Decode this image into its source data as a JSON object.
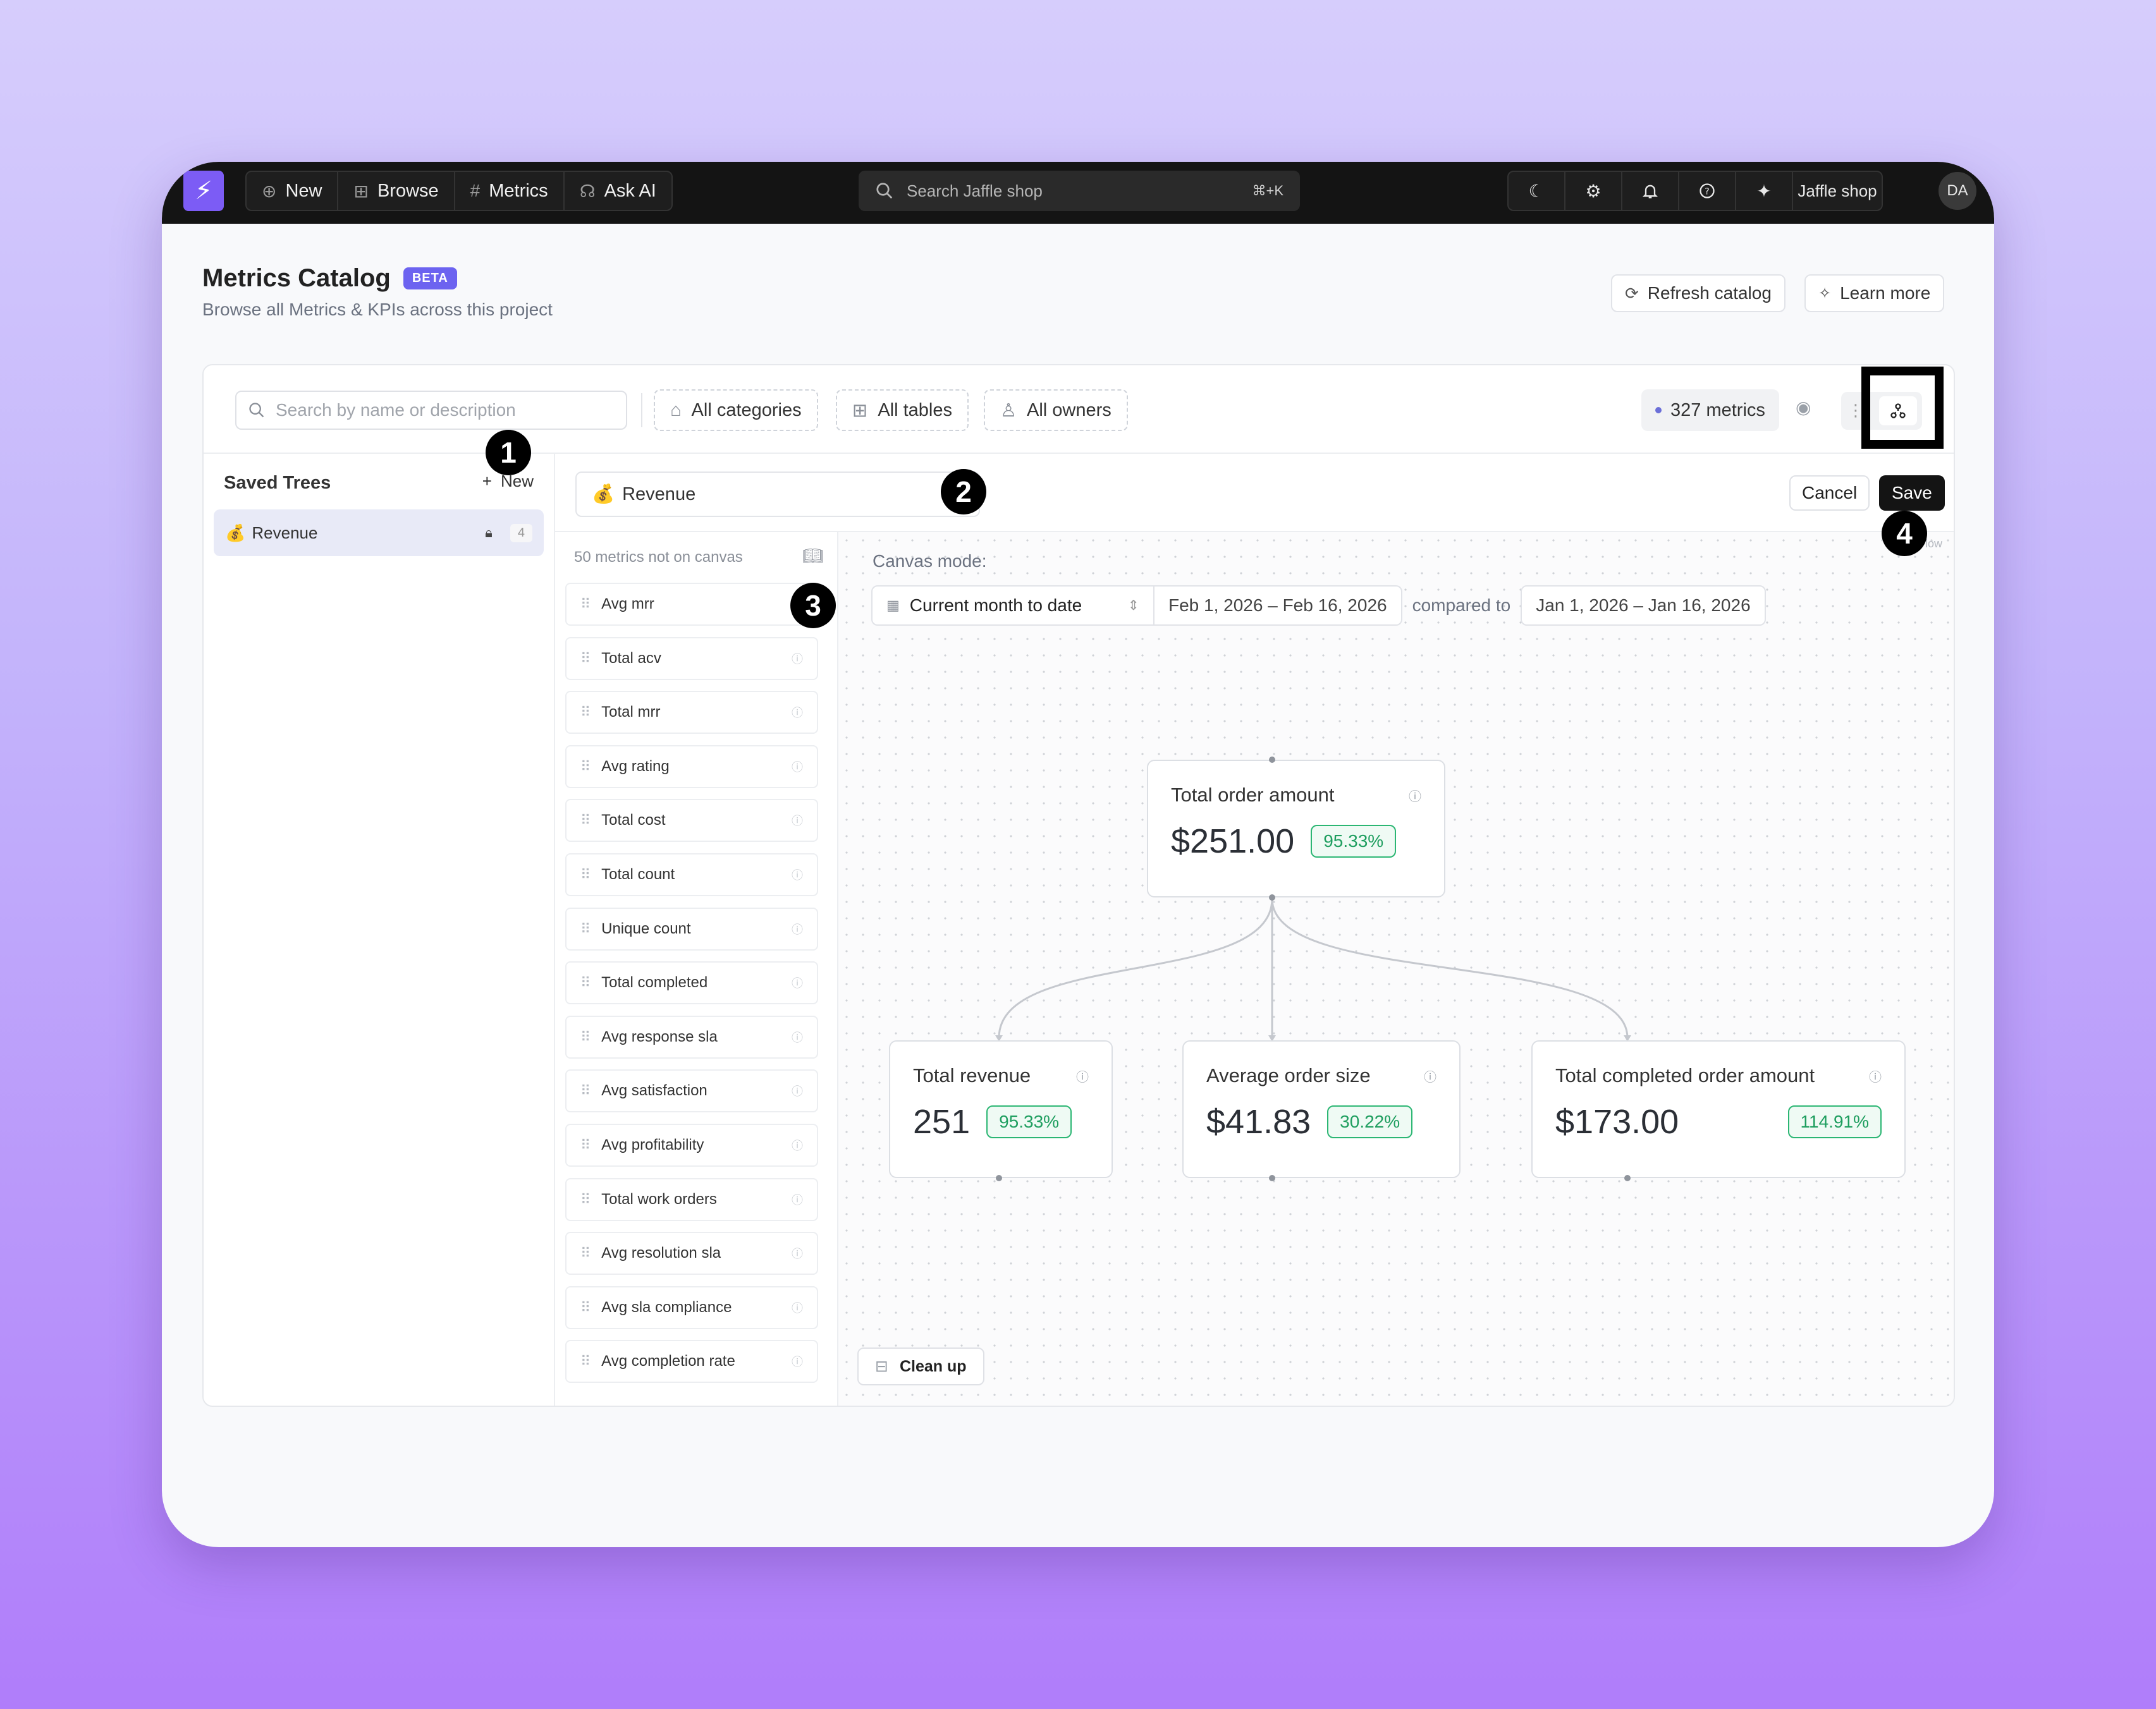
{
  "topbar": {
    "logo_glyph": "⚡",
    "nav": [
      {
        "icon": "⊕",
        "label": "New"
      },
      {
        "icon": "⊞",
        "label": "Browse"
      },
      {
        "icon": "#",
        "label": "Metrics"
      },
      {
        "icon": "☊",
        "label": "Ask AI"
      }
    ],
    "search_placeholder": "Search Jaffle shop",
    "search_shortcut": "⌘+K",
    "project": "Jaffle shop",
    "avatar": "DA"
  },
  "header": {
    "title": "Metrics Catalog",
    "badge": "BETA",
    "subtitle": "Browse all Metrics & KPIs across this project",
    "refresh_label": "Refresh catalog",
    "learn_label": "Learn more"
  },
  "filters": {
    "search_placeholder": "Search by name or description",
    "categories": "All categories",
    "tables": "All tables",
    "owners": "All owners",
    "metric_count": "327 metrics"
  },
  "sidebar": {
    "title": "Saved Trees",
    "new_label": "New",
    "items": [
      {
        "emoji": "💰",
        "label": "Revenue",
        "count": "4"
      }
    ]
  },
  "editor": {
    "tree_emoji": "💰",
    "tree_name": "Revenue",
    "cancel_label": "Cancel",
    "save_label": "Save"
  },
  "metrics_list": {
    "header": "50 metrics not on canvas",
    "items": [
      "Avg mrr",
      "Total acv",
      "Total mrr",
      "Avg rating",
      "Total cost",
      "Total count",
      "Unique count",
      "Total completed",
      "Avg response sla",
      "Avg satisfaction",
      "Avg profitability",
      "Total work orders",
      "Avg resolution sla",
      "Avg sla compliance",
      "Avg completion rate"
    ]
  },
  "canvas": {
    "mode_label": "Canvas mode:",
    "flow_tag": "Flow",
    "period": "Current month to date",
    "range": "Feb 1, 2026 – Feb 16, 2026",
    "compared_label": "compared to",
    "compare_range": "Jan 1, 2026 – Jan 16, 2026",
    "cleanup_label": "Clean up",
    "nodes": [
      {
        "title": "Total order amount",
        "value": "$251.00",
        "change": "95.33%"
      },
      {
        "title": "Total revenue",
        "value": "251",
        "change": "95.33%"
      },
      {
        "title": "Average order size",
        "value": "$41.83",
        "change": "30.22%"
      },
      {
        "title": "Total completed order amount",
        "value": "$173.00",
        "change": "114.91%"
      }
    ]
  },
  "steps": [
    "1",
    "2",
    "3",
    "4"
  ],
  "colors": {
    "accent": "#7c5cf5",
    "beta": "#6c63f0",
    "positive": "#1e9e5f",
    "topbar": "#141414"
  }
}
